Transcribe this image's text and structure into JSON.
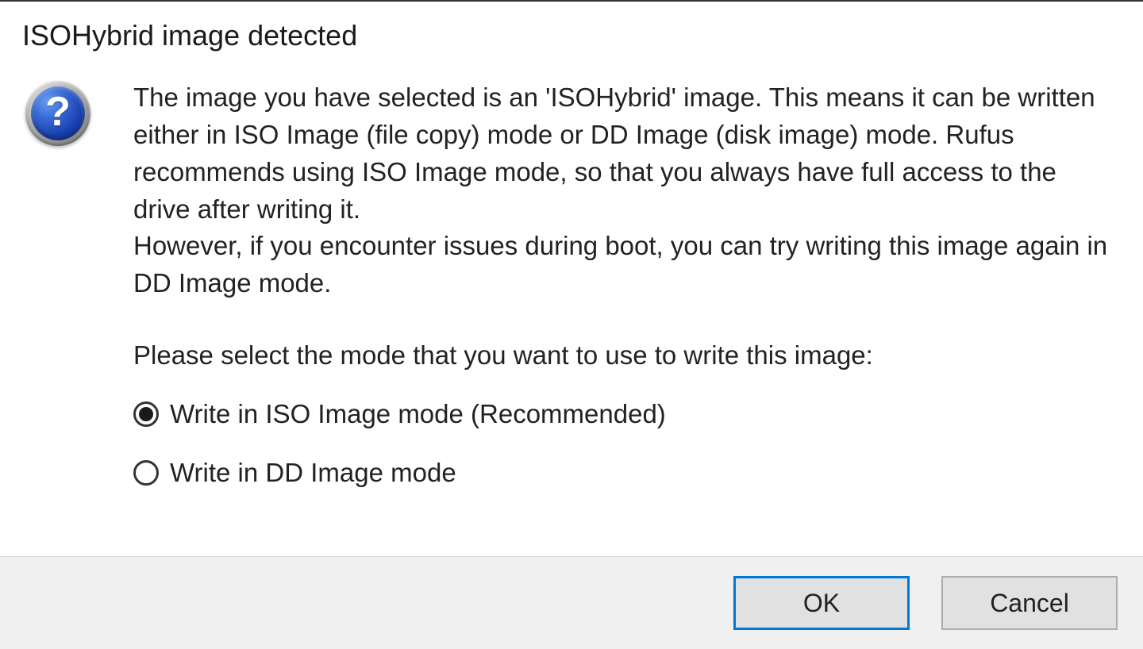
{
  "dialog": {
    "title": "ISOHybrid image detected",
    "icon": "question-icon",
    "message_line1": "The image you have selected is an 'ISOHybrid' image. This means it can be written either in ISO Image (file copy) mode or DD Image (disk image) mode.",
    "message_line2": "Rufus recommends using ISO Image mode, so that you always have full access to the drive after writing it.",
    "message_line3": "However, if you encounter issues during boot, you can try writing this image again in DD Image mode.",
    "prompt": "Please select the mode that you want to use to write this image:",
    "options": [
      {
        "label": "Write in ISO Image mode (Recommended)",
        "selected": true
      },
      {
        "label": "Write in DD Image mode",
        "selected": false
      }
    ],
    "buttons": {
      "ok": "OK",
      "cancel": "Cancel"
    }
  }
}
